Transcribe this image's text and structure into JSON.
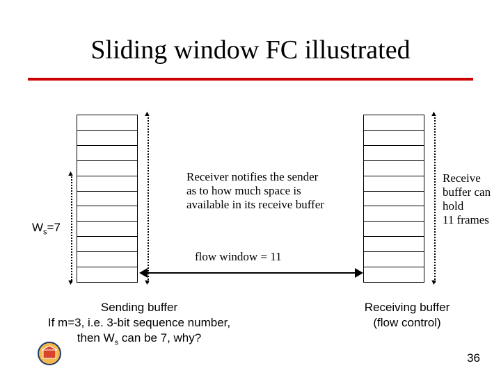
{
  "title": "Sliding window FC illustrated",
  "ws_label_html": "W<sub>s</sub>=7",
  "mid_text": "Receiver notifies the sender as to how much space is available in its receive buffer",
  "flow_window_text": "flow window = 11",
  "recv_text": "Receive buffer can hold 11 frames",
  "sending_caption_html": "Sending buffer<br>If m=3, i.e. 3-bit sequence number,<br>then W<sub>s</sub> can be 7, why?",
  "receiving_caption_html": "Receiving buffer<br>(flow control)",
  "slide_number": "36",
  "buffers": {
    "send_cells": 11,
    "recv_cells": 11,
    "ws": 7
  }
}
